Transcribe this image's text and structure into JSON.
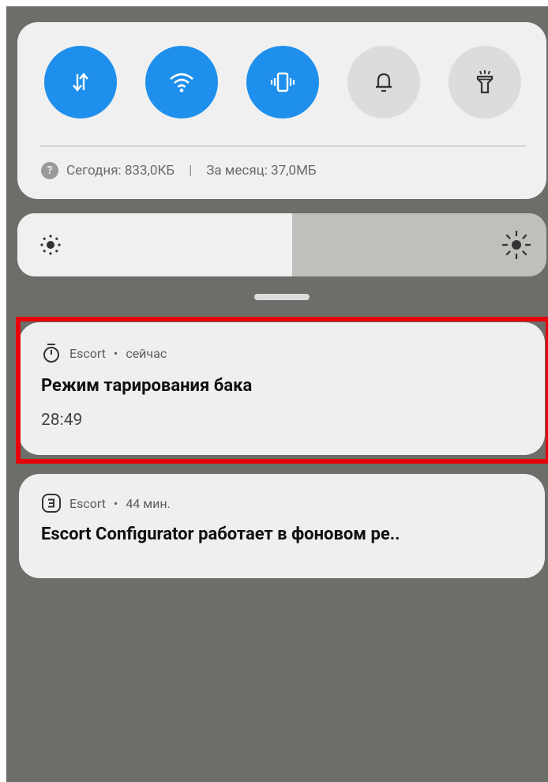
{
  "quick_settings": {
    "toggles": [
      {
        "name": "mobile-data",
        "icon": "data-transfer-icon",
        "state": "on"
      },
      {
        "name": "wifi",
        "icon": "wifi-icon",
        "state": "on"
      },
      {
        "name": "vibrate",
        "icon": "vibrate-icon",
        "state": "on"
      },
      {
        "name": "sound",
        "icon": "bell-icon",
        "state": "off"
      },
      {
        "name": "flashlight",
        "icon": "flashlight-icon",
        "state": "off"
      }
    ],
    "data_usage": {
      "today": "Сегодня: 833,0КБ",
      "separator": "|",
      "month": "За месяц: 37,0МБ"
    }
  },
  "brightness": {
    "level": 0.52
  },
  "notifications": [
    {
      "app": "Escort",
      "time": "сейчас",
      "icon": "stopwatch-icon",
      "title": "Режим тарирования бака",
      "body": "28:49",
      "highlighted": true
    },
    {
      "app": "Escort",
      "time": "44 мин.",
      "icon": "escort-app-icon",
      "title": "Escort Configurator работает в фоновом ре.."
    }
  ],
  "colors": {
    "toggle_on": "#1e8fec",
    "toggle_off": "#dcdcda",
    "highlight": "#e8000b",
    "shade_background": "#6b6e69"
  }
}
